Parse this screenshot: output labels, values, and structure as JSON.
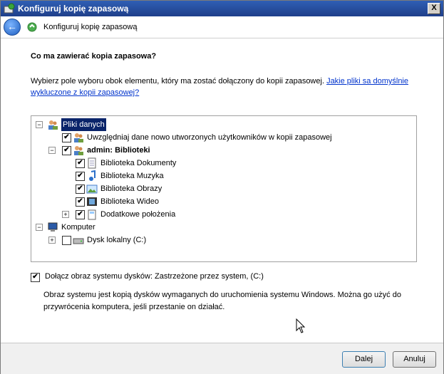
{
  "window": {
    "title": "Konfiguruj kopię zapasową",
    "close_label": "X"
  },
  "nav": {
    "back_label": "←",
    "title": "Konfiguruj kopię zapasową"
  },
  "main": {
    "heading": "Co ma zawierać kopia zapasowa?",
    "description": "Wybierz pole wyboru obok elementu, który ma zostać dołączony do kopii zapasowej.",
    "link": "Jakie pliki sa domyślnie wykluczone z kopii zapasowej?"
  },
  "tree": [
    {
      "label": "Pliki danych",
      "expander": "−",
      "checked": null,
      "icon": "users-icon",
      "selected": true
    },
    {
      "label": "Uwzględniaj dane nowo utworzonych użytkowników w kopii zapasowej",
      "expander": null,
      "checked": true,
      "icon": "users-icon"
    },
    {
      "label": "admin: Biblioteki",
      "expander": "−",
      "checked": true,
      "icon": "users-icon",
      "bold": true
    },
    {
      "label": "Biblioteka Dokumenty",
      "expander": null,
      "checked": true,
      "icon": "document-icon"
    },
    {
      "label": "Biblioteka Muzyka",
      "expander": null,
      "checked": true,
      "icon": "music-icon"
    },
    {
      "label": "Biblioteka Obrazy",
      "expander": null,
      "checked": true,
      "icon": "pictures-icon"
    },
    {
      "label": "Biblioteka Wideo",
      "expander": null,
      "checked": true,
      "icon": "video-icon"
    },
    {
      "label": "Dodatkowe położenia",
      "expander": "+",
      "checked": true,
      "icon": "folder-icon"
    },
    {
      "label": "Komputer",
      "expander": "−",
      "checked": null,
      "icon": "computer-icon"
    },
    {
      "label": "Dysk lokalny (C:)",
      "expander": "+",
      "checked": false,
      "icon": "drive-icon"
    }
  ],
  "system_image": {
    "label": "Dołącz obraz systemu dysków: Zastrzeżone przez system, (C:)",
    "checked": true,
    "description": "Obraz systemu jest kopią dysków wymaganych do uruchomienia systemu Windows. Można go użyć do przywrócenia komputera, jeśli przestanie on działać."
  },
  "footer": {
    "next_label": "Dalej",
    "cancel_label": "Anuluj"
  }
}
